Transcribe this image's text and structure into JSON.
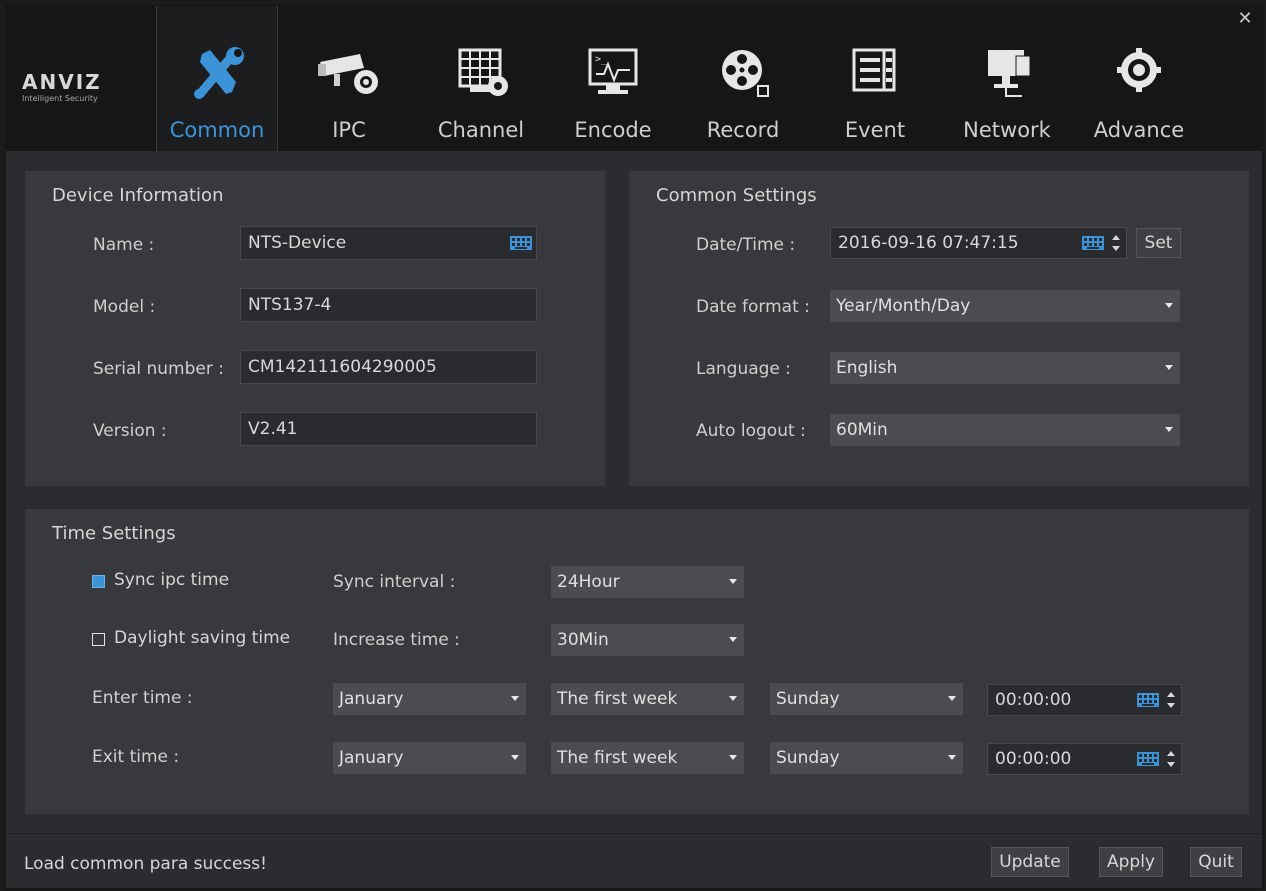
{
  "window": {
    "close_glyph": "✕"
  },
  "logo": {
    "brand": "ANVIZ",
    "tagline": "Intelligent Security"
  },
  "tabs": [
    {
      "label": "Common",
      "icon": "tools-icon",
      "active": true
    },
    {
      "label": "IPC",
      "icon": "camera-icon",
      "active": false
    },
    {
      "label": "Channel",
      "icon": "channel-grid-icon",
      "active": false
    },
    {
      "label": "Encode",
      "icon": "encode-monitor-icon",
      "active": false
    },
    {
      "label": "Record",
      "icon": "film-reel-icon",
      "active": false
    },
    {
      "label": "Event",
      "icon": "event-list-icon",
      "active": false
    },
    {
      "label": "Network",
      "icon": "network-icon",
      "active": false
    },
    {
      "label": "Advance",
      "icon": "advance-gear-icon",
      "active": false
    }
  ],
  "device_info": {
    "title": "Device Information",
    "name_label": "Name :",
    "name_value": "NTS-Device",
    "model_label": "Model :",
    "model_value": "NTS137-4",
    "serial_label": "Serial number :",
    "serial_value": "CM142111604290005",
    "version_label": "Version :",
    "version_value": "V2.41"
  },
  "common_settings": {
    "title": "Common Settings",
    "datetime_label": "Date/Time :",
    "datetime_value": "2016-09-16 07:47:15",
    "set_button": "Set",
    "date_format_label": "Date format :",
    "date_format_value": "Year/Month/Day",
    "language_label": "Language :",
    "language_value": "English",
    "auto_logout_label": "Auto logout :",
    "auto_logout_value": "60Min"
  },
  "time_settings": {
    "title": "Time Settings",
    "sync_ipc_label": "Sync ipc time",
    "sync_ipc_checked": true,
    "sync_interval_label": "Sync interval :",
    "sync_interval_value": "24Hour",
    "dst_label": "Daylight saving time",
    "dst_checked": false,
    "increase_time_label": "Increase time :",
    "increase_time_value": "30Min",
    "enter_time_label": "Enter time :",
    "enter_month": "January",
    "enter_week": "The first week",
    "enter_day": "Sunday",
    "enter_time": "00:00:00",
    "exit_time_label": "Exit time :",
    "exit_month": "January",
    "exit_week": "The first week",
    "exit_day": "Sunday",
    "exit_time": "00:00:00"
  },
  "status": {
    "message": "Load common para success!",
    "update_button": "Update",
    "apply_button": "Apply",
    "quit_button": "Quit"
  },
  "colors": {
    "accent": "#3d93d8",
    "background": "#2b2c2f",
    "panel": "#38393c",
    "toolbar": "#151617"
  }
}
